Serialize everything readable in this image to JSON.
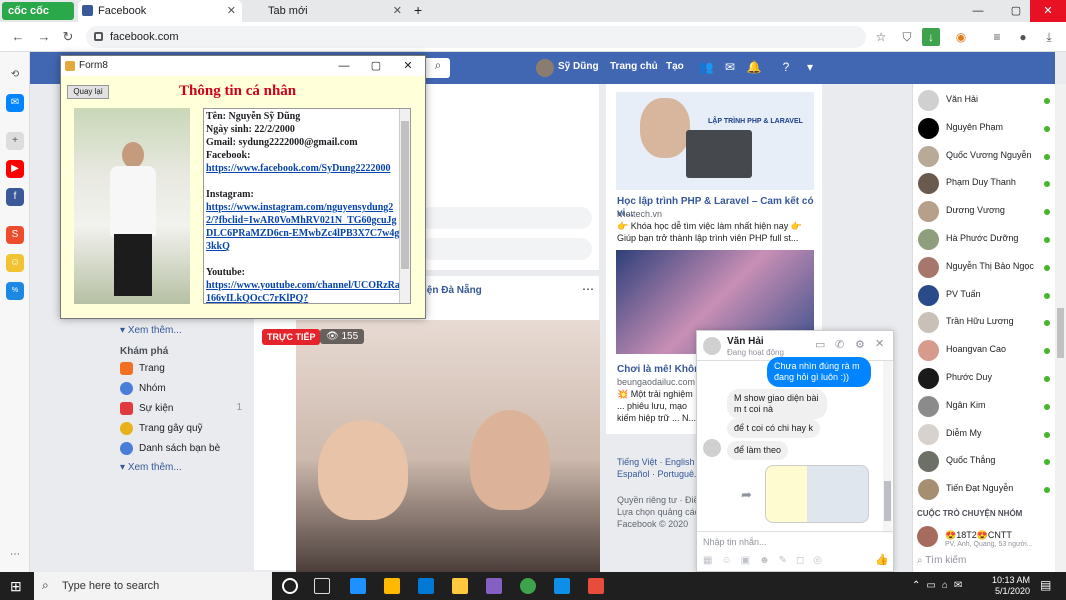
{
  "browser": {
    "logo": "cốc cốc",
    "tabs": [
      {
        "label": "Facebook"
      },
      {
        "label": "Tab mới"
      }
    ],
    "url": "facebook.com"
  },
  "facebook": {
    "user": "Sỹ Dũng",
    "home": "Trang chủ",
    "create": "Tạo"
  },
  "left_menu": {
    "see_more": "Xem thêm...",
    "explore": "Khám phá",
    "items": [
      {
        "label": "Trang"
      },
      {
        "label": "Nhóm"
      },
      {
        "label": "Sự kiện",
        "count": "1"
      },
      {
        "label": "Trang gây quỹ"
      },
      {
        "label": "Danh sách bạn bè"
      }
    ],
    "see_more2": "Xem thêm..."
  },
  "feed": {
    "location": "iện Đà Nẵng",
    "live": "TRỰC TIẾP",
    "views": "155"
  },
  "ads": [
    {
      "image_text": "LẬP TRÌNH PHP & LARAVEL",
      "title": "Học lập trình PHP & Laravel – Cam kết có vi...",
      "domain": "iviettech.vn",
      "text": "👉 Khóa học dễ tìm việc làm nhất hiện nay 👉 Giúp bạn trở thành lập trình viên PHP full st..."
    },
    {
      "title": "Chơi là mê! Không ...",
      "domain": "beungaodailuc.com",
      "text": "💥 Một trải nghiệm ... phiêu lưu, mạo kiếm hiệp trữ ... N..."
    }
  ],
  "footer": {
    "langs": "Tiếng Việt · English · Español · Portuguê...",
    "links": "Quyền riêng tư · Điề...",
    "adchoice": "Lựa chọn quảng các...",
    "copy": "Facebook © 2020"
  },
  "contacts": [
    {
      "name": "Văn Hải",
      "color": "#d0d0d0"
    },
    {
      "name": "Nguyên Phạm",
      "color": "#000000"
    },
    {
      "name": "Quốc Vương Nguyễn",
      "color": "#b9a997"
    },
    {
      "name": "Phạm Duy Thanh",
      "color": "#6a5a4e"
    },
    {
      "name": "Dương Vương",
      "color": "#b7a08a"
    },
    {
      "name": "Hà Phước Dưỡng",
      "color": "#8f9e7c"
    },
    {
      "name": "Nguyễn Thị Bảo Ngọc",
      "color": "#a6786b"
    },
    {
      "name": "PV Tuấn",
      "color": "#2a4a8a"
    },
    {
      "name": "Trần Hữu Lương",
      "color": "#c9c1b7"
    },
    {
      "name": "Hoangvan Cao",
      "color": "#d69b8d"
    },
    {
      "name": "Phước Duy",
      "color": "#1a1a1a"
    },
    {
      "name": "Ngân Kim",
      "color": "#8b8b8b"
    },
    {
      "name": "Diễm My",
      "color": "#d8d2cf"
    },
    {
      "name": "Quốc Thắng",
      "color": "#6d7067"
    },
    {
      "name": "Tiến Đạt Nguyễn",
      "color": "#a58e72"
    }
  ],
  "group_chat": {
    "heading": "CUỘC TRÒ CHUYỆN NHÓM",
    "name": "😍18T2😍CNTT",
    "members": "PV, Anh, Quang, 53 người...",
    "search": "Tìm kiếm"
  },
  "messenger": {
    "name": "Văn Hải",
    "status": "Đang hoạt động",
    "messages": [
      {
        "text": "Chưa nhìn đúng rà m đang hỏi gì luôn :))",
        "me": true
      },
      {
        "text": "M show giao diện bài m t coi nà",
        "me": false
      },
      {
        "text": "để t coi có chi hay k",
        "me": false
      },
      {
        "text": "để làm theo",
        "me": false
      }
    ],
    "placeholder": "Nhập tin nhắn..."
  },
  "form": {
    "title": "Form8",
    "back": "Quay lại",
    "heading": "Thông tin cá nhân",
    "name": "Tên: Nguyễn Sỹ Dũng",
    "dob": "Ngày sinh: 22/2/2000",
    "gmail": "Gmail: sydung2222000@gmail.com",
    "fb_label": "Facebook:",
    "fb_link": "https://www.facebook.com/SyDung2222000",
    "ig_label": "Instagram:",
    "ig_link": "https://www.instagram.com/nguyensydung22/?fbclid=IwAR0VoMhRV021N_TG60gcuJgDLC6PRaMZD6cn-EMwbZc4lPB3X7C7w4g3kkQ",
    "yt_label": "Youtube:",
    "yt_link": "https://www.youtube.com/channel/UCORzRa166vILkQOcC7rKlPQ?"
  },
  "taskbar": {
    "search": "Type here to search",
    "time": "10:13 AM",
    "date": "5/1/2020"
  }
}
